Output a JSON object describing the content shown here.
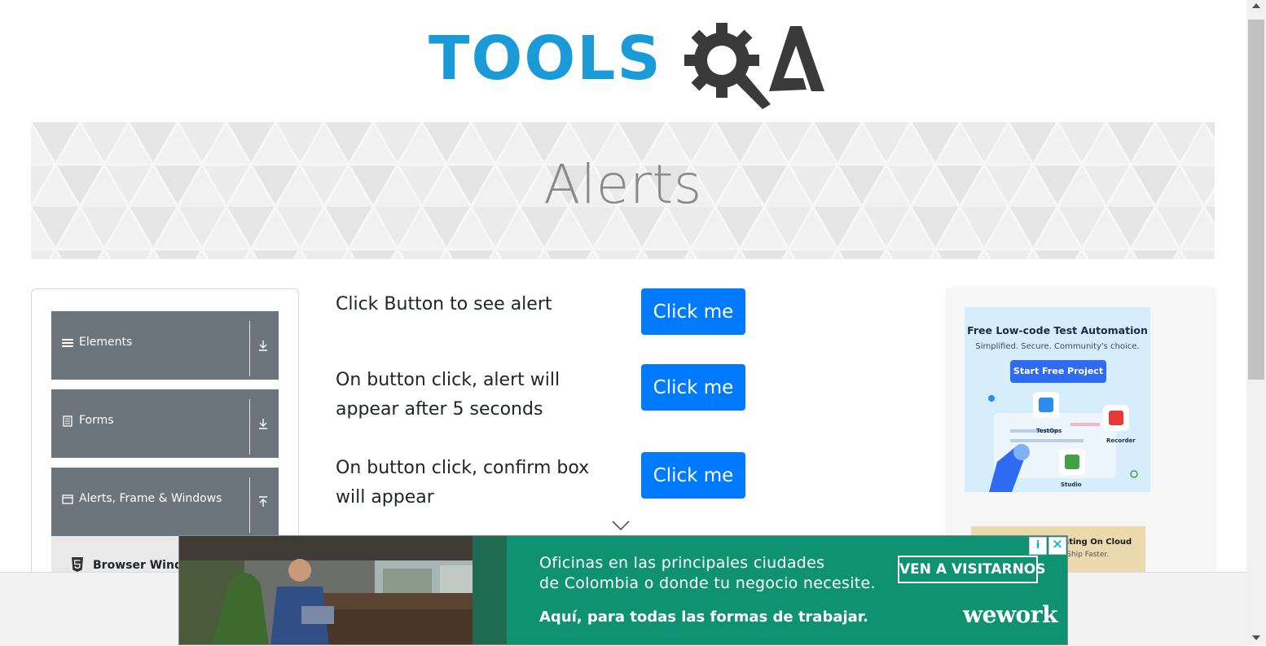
{
  "logo": {
    "text_tools": "TOOLS",
    "text_qa": "QA"
  },
  "banner": {
    "title": "Alerts"
  },
  "sidebar": {
    "groups": [
      {
        "label": "Elements",
        "icon": "hamburger-icon",
        "arrow": "expand-down-icon"
      },
      {
        "label": "Forms",
        "icon": "form-icon",
        "arrow": "expand-down-icon"
      },
      {
        "label": "Alerts, Frame & Windows",
        "icon": "window-icon",
        "arrow": "collapse-up-icon"
      }
    ],
    "active_item": {
      "label": "Browser Windows",
      "icon": "html5-icon"
    }
  },
  "main": {
    "rows": [
      {
        "text": "Click Button to see alert",
        "button": "Click me"
      },
      {
        "text": "On button click, alert will appear after 5 seconds",
        "button": "Click me"
      },
      {
        "text": "On button click, confirm box will appear",
        "button": "Click me"
      }
    ]
  },
  "right_ad": {
    "title": "Free Low-code Test Automation",
    "subtitle": "Simplified. Secure. Community's choice.",
    "cta": "Start Free Project",
    "labels": [
      "TestOps",
      "Recorder",
      "Studio"
    ],
    "second_title": "Testing On Cloud",
    "second_sub": "e. Ship Faster."
  },
  "bottom_ad": {
    "line1": "Oficinas en las principales ciudades",
    "line2": "de Colombia o donde tu negocio necesite.",
    "line3": "Aquí, para todas las formas de trabajar.",
    "cta": "VEN A VISITARNOS",
    "brand": "wework",
    "info": "i",
    "close": "✕"
  },
  "colors": {
    "primary_button": "#007bff",
    "sidebar_group": "#6c757d",
    "logo_blue": "#1a9ad7",
    "logo_dark": "#3a3a3a",
    "ad_green": "#0f9272"
  }
}
